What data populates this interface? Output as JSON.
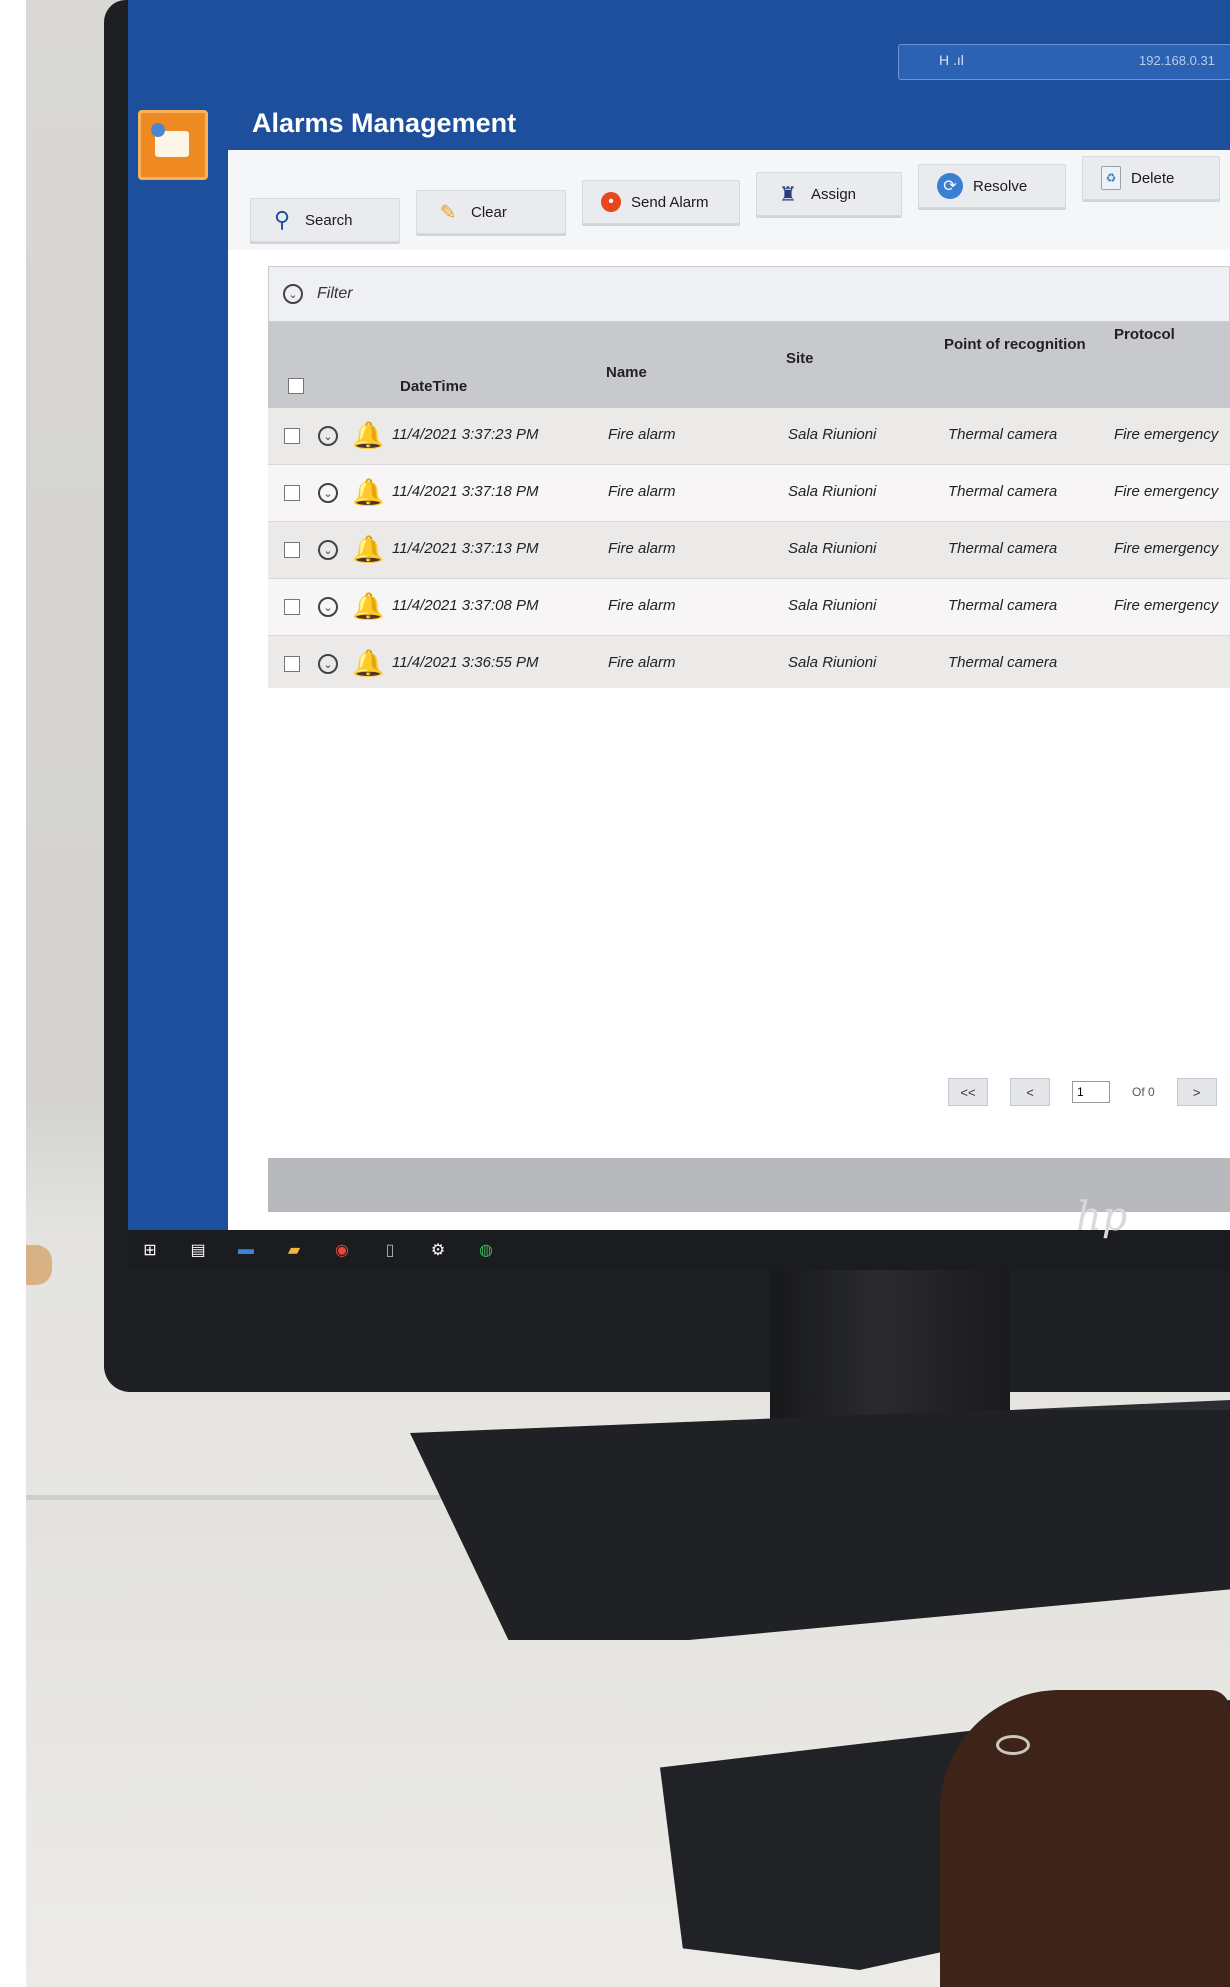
{
  "app": {
    "title": "Alarms Management",
    "ip": "192.168.0.31",
    "signal": "H .ıl"
  },
  "toolbar": {
    "search": "Search",
    "clear": "Clear",
    "send_alarm": "Send Alarm",
    "assign": "Assign",
    "resolve": "Resolve",
    "delete": "Delete"
  },
  "filter": {
    "label": "Filter"
  },
  "table": {
    "columns": {
      "datetime": "DateTime",
      "name": "Name",
      "site": "Site",
      "point": "Point of recognition",
      "protocol": "Protocol"
    },
    "rows": [
      {
        "datetime": "11/4/2021 3:37:23 PM",
        "name": "Fire alarm",
        "site": "Sala Riunioni",
        "point": "Thermal camera",
        "protocol": "Fire emergency"
      },
      {
        "datetime": "11/4/2021 3:37:18 PM",
        "name": "Fire alarm",
        "site": "Sala Riunioni",
        "point": "Thermal camera",
        "protocol": "Fire emergency"
      },
      {
        "datetime": "11/4/2021 3:37:13 PM",
        "name": "Fire alarm",
        "site": "Sala Riunioni",
        "point": "Thermal camera",
        "protocol": "Fire emergency"
      },
      {
        "datetime": "11/4/2021 3:37:08 PM",
        "name": "Fire alarm",
        "site": "Sala Riunioni",
        "point": "Thermal camera",
        "protocol": "Fire emergency"
      },
      {
        "datetime": "11/4/2021 3:36:55 PM",
        "name": "Fire alarm",
        "site": "Sala Riunioni",
        "point": "Thermal camera",
        "protocol": ""
      }
    ]
  },
  "pager": {
    "first": "<<",
    "prev": "<",
    "page": "1",
    "of": "Of 0",
    "next": ">"
  },
  "brand": "hp",
  "colors": {
    "header": "#1e4f9c",
    "alarm": "#e21a1a",
    "logo": "#ef8a22"
  }
}
